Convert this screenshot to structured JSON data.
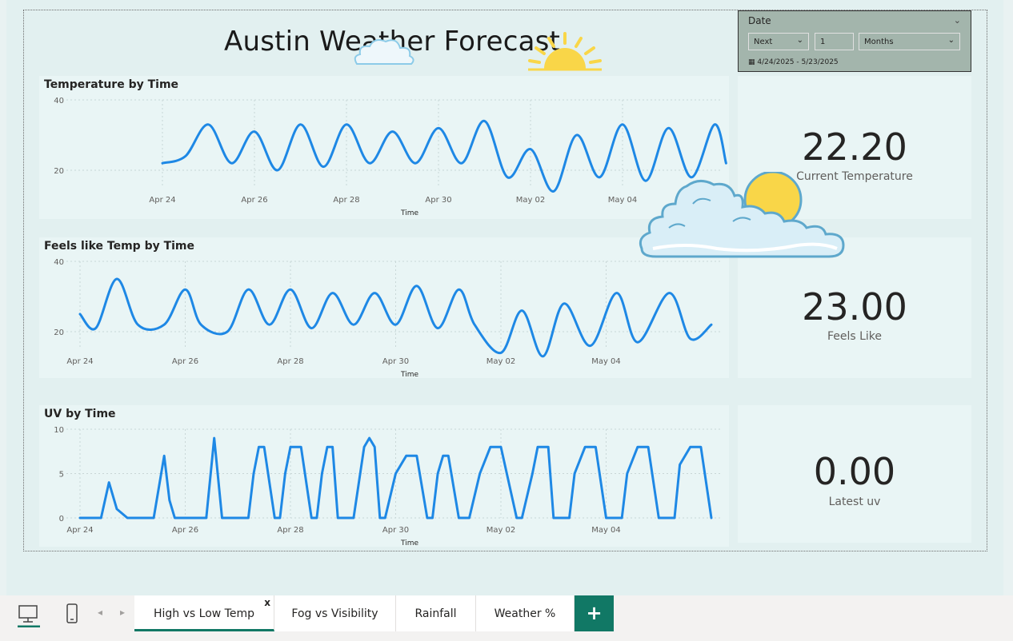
{
  "report": {
    "title": "Austin Weather Forecast"
  },
  "slicer": {
    "title": "Date",
    "mode": "Next",
    "count": "1",
    "unit": "Months",
    "range": "4/24/2025 - 5/23/2025"
  },
  "cards": {
    "temp": {
      "value": "22.20",
      "label": "Current Temperature"
    },
    "feels": {
      "value": "23.00",
      "label": "Feels Like"
    },
    "uv": {
      "value": "0.00",
      "label": "Latest uv"
    }
  },
  "tabs": {
    "items": [
      {
        "label": "High vs Low Temp"
      },
      {
        "label": "Fog vs Visibility"
      },
      {
        "label": "Rainfall"
      },
      {
        "label": "Weather %"
      }
    ],
    "close_label": "x",
    "add_label": "+"
  },
  "colors": {
    "line": "#1e88e5",
    "accent": "#117865",
    "sun": "#f9d648",
    "cloud": "#5ea8cc"
  },
  "chart_data": [
    {
      "type": "line",
      "title": "Temperature by Time",
      "xlabel": "Time",
      "ylabel": "",
      "ylim": [
        15,
        40
      ],
      "yticks": [
        20,
        40
      ],
      "xticks": [
        "Apr 24",
        "Apr 26",
        "Apr 28",
        "Apr 30",
        "May 02",
        "May 04"
      ],
      "xrange": [
        0,
        12.3
      ],
      "series": [
        {
          "x": [
            0,
            0.5,
            1,
            1.5,
            2,
            2.5,
            3,
            3.5,
            4,
            4.5,
            5,
            5.5,
            6,
            6.5,
            7,
            7.5,
            8,
            8.5,
            9,
            9.5,
            10,
            10.5,
            11,
            11.5,
            12,
            12.25
          ],
          "values": [
            22,
            24,
            33,
            22,
            31,
            20,
            33,
            21,
            33,
            22,
            31,
            22,
            32,
            22,
            34,
            18,
            26,
            14,
            30,
            18,
            33,
            17,
            32,
            18,
            33,
            22
          ]
        }
      ]
    },
    {
      "type": "line",
      "title": "Feels like Temp by Time",
      "xlabel": "Time",
      "ylabel": "",
      "ylim": [
        15,
        40
      ],
      "yticks": [
        20,
        40
      ],
      "xticks": [
        "Apr 24",
        "Apr 26",
        "Apr 28",
        "Apr 30",
        "May 02",
        "May 04"
      ],
      "xrange": [
        0,
        12.0
      ],
      "series": [
        {
          "x": [
            0,
            0.3,
            0.7,
            1.1,
            1.6,
            2.0,
            2.3,
            2.8,
            3.2,
            3.6,
            4.0,
            4.4,
            4.8,
            5.2,
            5.6,
            6.0,
            6.4,
            6.8,
            7.2,
            7.5,
            8.0,
            8.4,
            8.8,
            9.2,
            9.7,
            10.2,
            10.6,
            11.2,
            11.6,
            12.0
          ],
          "values": [
            25,
            21,
            35,
            22,
            22,
            32,
            22,
            20,
            32,
            22,
            32,
            21,
            31,
            22,
            31,
            22,
            33,
            21,
            32,
            22,
            14,
            26,
            13,
            28,
            16,
            31,
            17,
            31,
            18,
            22
          ]
        }
      ]
    },
    {
      "type": "line",
      "title": "UV by Time",
      "xlabel": "Time",
      "ylabel": "",
      "ylim": [
        0,
        10
      ],
      "yticks": [
        0,
        5,
        10
      ],
      "xticks": [
        "Apr 24",
        "Apr 26",
        "Apr 28",
        "Apr 30",
        "May 02",
        "May 04"
      ],
      "xrange": [
        0,
        12.0
      ],
      "series": [
        {
          "x": [
            0,
            0.4,
            0.55,
            0.7,
            0.9,
            1.4,
            1.6,
            1.7,
            1.8,
            1.95,
            2.1,
            2.4,
            2.55,
            2.7,
            2.85,
            3.0,
            3.2,
            3.3,
            3.4,
            3.5,
            3.7,
            3.8,
            3.9,
            4.0,
            4.2,
            4.4,
            4.5,
            4.6,
            4.7,
            4.8,
            4.9,
            5.0,
            5.2,
            5.4,
            5.5,
            5.6,
            5.7,
            5.8,
            6.0,
            6.2,
            6.4,
            6.6,
            6.7,
            6.8,
            6.9,
            7.0,
            7.2,
            7.4,
            7.6,
            7.8,
            8.0,
            8.3,
            8.4,
            8.6,
            8.7,
            8.9,
            9.0,
            9.3,
            9.4,
            9.6,
            9.8,
            10.0,
            10.3,
            10.4,
            10.6,
            10.8,
            11.0,
            11.3,
            11.4,
            11.6,
            11.8,
            12.0
          ],
          "values": [
            0,
            0,
            4,
            1,
            0,
            0,
            7,
            2,
            0,
            0,
            0,
            0,
            9,
            0,
            0,
            0,
            0,
            5,
            8,
            8,
            0,
            0,
            5,
            8,
            8,
            0,
            0,
            5,
            8,
            8,
            0,
            0,
            0,
            8,
            9,
            8,
            0,
            0,
            5,
            7,
            7,
            0,
            0,
            5,
            7,
            7,
            0,
            0,
            5,
            8,
            8,
            0,
            0,
            5,
            8,
            8,
            0,
            0,
            5,
            8,
            8,
            0,
            0,
            5,
            8,
            8,
            0,
            0,
            6,
            8,
            8,
            0
          ]
        }
      ]
    }
  ]
}
